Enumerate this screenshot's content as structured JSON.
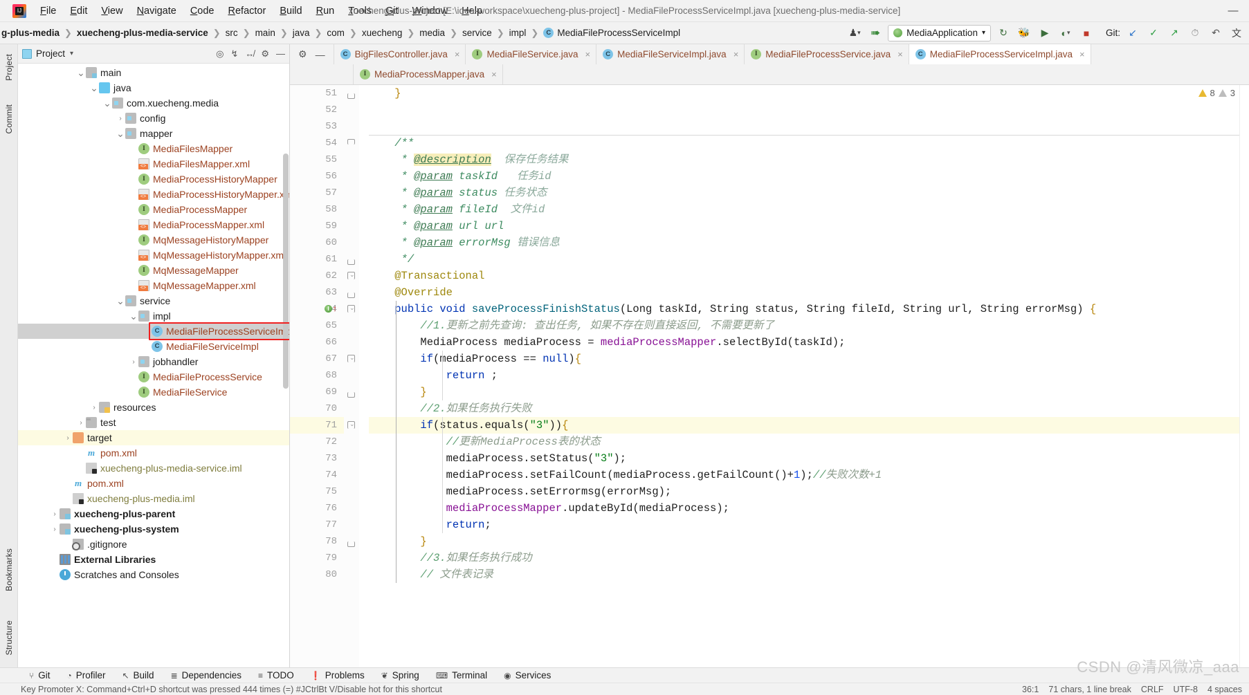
{
  "window": {
    "title": "xuecheng-plus-project [E:\\idea-workspace\\xuecheng-plus-project] - MediaFileProcessServiceImpl.java [xuecheng-plus-media-service]",
    "minimize_label": "—",
    "logo_name": "intellij-idea-logo"
  },
  "menu": [
    {
      "label": "File"
    },
    {
      "label": "Edit"
    },
    {
      "label": "View"
    },
    {
      "label": "Navigate"
    },
    {
      "label": "Code"
    },
    {
      "label": "Refactor"
    },
    {
      "label": "Build"
    },
    {
      "label": "Run"
    },
    {
      "label": "Tools"
    },
    {
      "label": "Git"
    },
    {
      "label": "Window"
    },
    {
      "label": "Help"
    }
  ],
  "breadcrumb": {
    "items": [
      {
        "label": "g-plus-media",
        "bold": true,
        "icon": ""
      },
      {
        "label": "xuecheng-plus-media-service",
        "bold": true,
        "icon": ""
      },
      {
        "label": "src",
        "bold": false,
        "icon": ""
      },
      {
        "label": "main",
        "bold": false,
        "icon": ""
      },
      {
        "label": "java",
        "bold": false,
        "icon": ""
      },
      {
        "label": "com",
        "bold": false,
        "icon": ""
      },
      {
        "label": "xuecheng",
        "bold": false,
        "icon": ""
      },
      {
        "label": "media",
        "bold": false,
        "icon": ""
      },
      {
        "label": "service",
        "bold": false,
        "icon": ""
      },
      {
        "label": "impl",
        "bold": false,
        "icon": ""
      },
      {
        "label": "MediaFileProcessServiceImpl",
        "bold": false,
        "icon": "class"
      }
    ]
  },
  "toolbar": {
    "run_config": "MediaApplication",
    "run_config_caret": "▾",
    "git_label": "Git:",
    "icons": [
      {
        "name": "user-avatar-icon",
        "glyph": "♟"
      },
      {
        "name": "hammer-build-icon",
        "glyph": "↖"
      },
      {
        "name": "rerun-icon",
        "glyph": "↻"
      },
      {
        "name": "debug-icon",
        "glyph": "⚙"
      },
      {
        "name": "run-with-coverage-icon",
        "glyph": "▶"
      },
      {
        "name": "profiler-icon",
        "glyph": "◔"
      },
      {
        "name": "stop-icon",
        "glyph": "■"
      },
      {
        "name": "git-update-icon",
        "glyph": "↙"
      },
      {
        "name": "git-commit-icon",
        "glyph": "✓"
      },
      {
        "name": "git-push-icon",
        "glyph": "↗"
      },
      {
        "name": "git-history-icon",
        "glyph": "◴"
      },
      {
        "name": "git-rollback-icon",
        "glyph": "↶"
      },
      {
        "name": "search-everywhere-icon",
        "glyph": "文"
      }
    ]
  },
  "left_stripe": {
    "top_label": "Project",
    "commit_label": "Commit",
    "bookmarks_label": "Bookmarks",
    "structure_label": "Structure"
  },
  "project_panel": {
    "title": "Project",
    "caret": "▾",
    "actions": [
      {
        "name": "select-opened-file-icon",
        "glyph": "⌖"
      },
      {
        "name": "expand-all-icon",
        "glyph": "⤓"
      },
      {
        "name": "collapse-all-icon",
        "glyph": "⤒"
      },
      {
        "name": "settings-gear-icon",
        "glyph": "⚙"
      },
      {
        "name": "hide-panel-icon",
        "glyph": "—"
      }
    ],
    "tree": [
      {
        "label": "main",
        "indent": 4,
        "arrow": "v",
        "icon": "folder-src",
        "color": "plain"
      },
      {
        "label": "java",
        "indent": 5,
        "arrow": "v",
        "icon": "folder-blue",
        "color": "plain"
      },
      {
        "label": "com.xuecheng.media",
        "indent": 6,
        "arrow": "v",
        "icon": "pkg",
        "color": "plain"
      },
      {
        "label": "config",
        "indent": 7,
        "arrow": ">",
        "icon": "pkg",
        "color": "plain"
      },
      {
        "label": "mapper",
        "indent": 7,
        "arrow": "v",
        "icon": "pkg",
        "color": "plain"
      },
      {
        "label": "MediaFilesMapper",
        "indent": 8,
        "arrow": "",
        "icon": "iface",
        "color": "brown"
      },
      {
        "label": "MediaFilesMapper.xml",
        "indent": 8,
        "arrow": "",
        "icon": "xml",
        "color": "brown"
      },
      {
        "label": "MediaProcessHistoryMapper",
        "indent": 8,
        "arrow": "",
        "icon": "iface",
        "color": "brown"
      },
      {
        "label": "MediaProcessHistoryMapper.xml",
        "indent": 8,
        "arrow": "",
        "icon": "xml",
        "color": "brown"
      },
      {
        "label": "MediaProcessMapper",
        "indent": 8,
        "arrow": "",
        "icon": "iface",
        "color": "brown"
      },
      {
        "label": "MediaProcessMapper.xml",
        "indent": 8,
        "arrow": "",
        "icon": "xml",
        "color": "brown"
      },
      {
        "label": "MqMessageHistoryMapper",
        "indent": 8,
        "arrow": "",
        "icon": "iface",
        "color": "brown"
      },
      {
        "label": "MqMessageHistoryMapper.xml",
        "indent": 8,
        "arrow": "",
        "icon": "xml",
        "color": "brown"
      },
      {
        "label": "MqMessageMapper",
        "indent": 8,
        "arrow": "",
        "icon": "iface",
        "color": "brown"
      },
      {
        "label": "MqMessageMapper.xml",
        "indent": 8,
        "arrow": "",
        "icon": "xml",
        "color": "brown"
      },
      {
        "label": "service",
        "indent": 7,
        "arrow": "v",
        "icon": "pkg",
        "color": "plain"
      },
      {
        "label": "impl",
        "indent": 8,
        "arrow": "v",
        "icon": "pkg",
        "color": "plain"
      },
      {
        "label": "MediaFileProcessServiceImpl",
        "indent": 9,
        "arrow": "",
        "icon": "clazz",
        "color": "brown",
        "selected": true,
        "highlight_box": true
      },
      {
        "label": "MediaFileServiceImpl",
        "indent": 9,
        "arrow": "",
        "icon": "clazz",
        "color": "brown"
      },
      {
        "label": "jobhandler",
        "indent": 8,
        "arrow": ">",
        "icon": "pkg",
        "color": "plain"
      },
      {
        "label": "MediaFileProcessService",
        "indent": 8,
        "arrow": "",
        "icon": "iface",
        "color": "brown"
      },
      {
        "label": "MediaFileService",
        "indent": 8,
        "arrow": "",
        "icon": "iface",
        "color": "brown"
      },
      {
        "label": "resources",
        "indent": 5,
        "arrow": ">",
        "icon": "folder-res",
        "color": "plain"
      },
      {
        "label": "test",
        "indent": 4,
        "arrow": ">",
        "icon": "folder",
        "color": "plain"
      },
      {
        "label": "target",
        "indent": 3,
        "arrow": ">",
        "icon": "folder-orange",
        "color": "plain",
        "marked": true
      },
      {
        "label": "pom.xml",
        "indent": 4,
        "arrow": "",
        "icon": "maven",
        "color": "brown"
      },
      {
        "label": "xuecheng-plus-media-service.iml",
        "indent": 4,
        "arrow": "",
        "icon": "iml",
        "color": "olive"
      },
      {
        "label": "pom.xml",
        "indent": 3,
        "arrow": "",
        "icon": "maven",
        "color": "brown"
      },
      {
        "label": "xuecheng-plus-media.iml",
        "indent": 3,
        "arrow": "",
        "icon": "iml",
        "color": "olive"
      },
      {
        "label": "xuecheng-plus-parent",
        "indent": 2,
        "arrow": ">",
        "icon": "module",
        "color": "bold"
      },
      {
        "label": "xuecheng-plus-system",
        "indent": 2,
        "arrow": ">",
        "icon": "module",
        "color": "bold"
      },
      {
        "label": ".gitignore",
        "indent": 3,
        "arrow": "",
        "icon": "gitignore",
        "color": "plain"
      },
      {
        "label": "External Libraries",
        "indent": 2,
        "arrow": "",
        "icon": "lib",
        "color": "bold"
      },
      {
        "label": "Scratches and Consoles",
        "indent": 2,
        "arrow": "",
        "icon": "scratch",
        "color": "plain"
      }
    ]
  },
  "editor": {
    "tab_actions": [
      {
        "name": "settings-gear-icon",
        "glyph": "⚙"
      },
      {
        "name": "hide-editor-icon",
        "glyph": "—"
      }
    ],
    "tabs_row1": [
      {
        "label": "BigFilesController.java",
        "kind": "class",
        "active": false
      },
      {
        "label": "MediaFileService.java",
        "kind": "interface",
        "active": false
      },
      {
        "label": "MediaFileServiceImpl.java",
        "kind": "class",
        "active": false
      },
      {
        "label": "MediaFileProcessService.java",
        "kind": "interface",
        "active": false
      },
      {
        "label": "MediaFileProcessServiceImpl.java",
        "kind": "class",
        "active": true
      }
    ],
    "tabs_row2": [
      {
        "label": "MediaProcessMapper.java",
        "kind": "interface",
        "active": false
      }
    ],
    "close_glyph": "×",
    "inspection": {
      "warnings": "8",
      "weak_warnings": "3",
      "warn_icon": "warning-triangle-icon"
    },
    "first_line": 51,
    "lines": [
      {
        "n": 51,
        "fold": "close",
        "html": "    <span class='brace-y'>}</span>"
      },
      {
        "n": 52,
        "fold": "",
        "html": ""
      },
      {
        "n": 53,
        "fold": "",
        "html": ""
      },
      {
        "n": 54,
        "fold": "open",
        "sep": true,
        "html": "    <span class='jdoc'>/**</span>"
      },
      {
        "n": 55,
        "fold": "",
        "html": "     <span class='jdoc'>* </span><span class='jdoc-tag hl'>@description</span><span class='jdoc-txt'>  保存任务结果</span>"
      },
      {
        "n": 56,
        "fold": "",
        "html": "     <span class='jdoc'>* </span><span class='jdoc-tag'>@param</span><span class='jdoc'> taskId</span><span class='jdoc-txt'>   任务id</span>"
      },
      {
        "n": 57,
        "fold": "",
        "html": "     <span class='jdoc'>* </span><span class='jdoc-tag'>@param</span><span class='jdoc'> status</span><span class='jdoc-txt'> 任务状态</span>"
      },
      {
        "n": 58,
        "fold": "",
        "html": "     <span class='jdoc'>* </span><span class='jdoc-tag'>@param</span><span class='jdoc'> fileId</span><span class='jdoc-txt'>  文件id</span>"
      },
      {
        "n": 59,
        "fold": "",
        "html": "     <span class='jdoc'>* </span><span class='jdoc-tag'>@param</span><span class='jdoc'> url url</span>"
      },
      {
        "n": 60,
        "fold": "",
        "html": "     <span class='jdoc'>* </span><span class='jdoc-tag'>@param</span><span class='jdoc'> errorMsg</span><span class='jdoc-txt'> 错误信息</span>"
      },
      {
        "n": 61,
        "fold": "close",
        "html": "     <span class='jdoc'>*/</span>"
      },
      {
        "n": 62,
        "fold": "collapse",
        "html": "    <span class='anno'>@Transactional</span>"
      },
      {
        "n": 63,
        "fold": "close",
        "html": "    <span class='anno'>@Override</span>"
      },
      {
        "n": 64,
        "fold": "collapse",
        "run": true,
        "html": "    <span class='kw'>public</span> <span class='kw'>void</span> <span class='fn'>saveProcessFinishStatus</span><span class='punc'>(</span><span class='typ'>Long taskId, String status, String fileId, String url, String errorMsg</span><span class='punc'>)</span> <span class='brace-y'>{</span>"
      },
      {
        "n": 65,
        "fold": "",
        "html": "        <span class='cmt-green'>//1.</span><span class='cmt-chs'>更新之前先查询: 查出任务, 如果不存在则直接返回, 不需要更新了</span>"
      },
      {
        "n": 66,
        "fold": "",
        "html": "        <span class='typ'>MediaProcess mediaProcess</span> <span class='punc'>=</span> <span class='fld'>mediaProcessMapper</span><span class='punc'>.</span><span class='typ'>selectById</span><span class='punc'>(</span><span class='typ'>taskId</span><span class='punc'>);</span>"
      },
      {
        "n": 67,
        "fold": "collapse",
        "html": "        <span class='kw'>if</span><span class='punc'>(</span><span class='typ'>mediaProcess</span> <span class='punc'>==</span> <span class='kw'>null</span><span class='punc'>)</span><span class='brace-y'>{</span>"
      },
      {
        "n": 68,
        "fold": "",
        "html": "            <span class='kw'>return</span> <span class='punc'>;</span>"
      },
      {
        "n": 69,
        "fold": "close",
        "html": "        <span class='brace-y'>}</span>"
      },
      {
        "n": 70,
        "fold": "",
        "html": "        <span class='cmt-green'>//2.</span><span class='cmt-chs'>如果任务执行失败</span>"
      },
      {
        "n": 71,
        "fold": "collapse",
        "marked": true,
        "html": "        <span class='kw'>if</span><span class='punc'>(</span><span class='typ'>status</span><span class='punc'>.</span><span class='typ'>equals</span><span class='punc'>(</span><span class='str'>\"3\"</span><span class='punc'>))</span><span class='brace-y'>{</span>"
      },
      {
        "n": 72,
        "fold": "",
        "html": "            <span class='cmt-green'>//</span><span class='cmt-chs'>更新MediaProcess表的状态</span>"
      },
      {
        "n": 73,
        "fold": "",
        "html": "            <span class='typ'>mediaProcess</span><span class='punc'>.</span><span class='typ'>setStatus</span><span class='punc'>(</span><span class='str'>\"3\"</span><span class='punc'>);</span>"
      },
      {
        "n": 74,
        "fold": "",
        "html": "            <span class='typ'>mediaProcess</span><span class='punc'>.</span><span class='typ'>setFailCount</span><span class='punc'>(</span><span class='typ'>mediaProcess</span><span class='punc'>.</span><span class='typ'>getFailCount</span><span class='punc'>()+</span><span class='num'>1</span><span class='punc'>);</span><span class='cmt-green'>//</span><span class='cmt-chs'>失败次数+1</span>"
      },
      {
        "n": 75,
        "fold": "",
        "html": "            <span class='typ'>mediaProcess</span><span class='punc'>.</span><span class='typ'>setErrormsg</span><span class='punc'>(</span><span class='typ'>errorMsg</span><span class='punc'>);</span>"
      },
      {
        "n": 76,
        "fold": "",
        "html": "            <span class='fld'>mediaProcessMapper</span><span class='punc'>.</span><span class='typ'>updateById</span><span class='punc'>(</span><span class='typ'>mediaProcess</span><span class='punc'>);</span>"
      },
      {
        "n": 77,
        "fold": "",
        "html": "            <span class='kw'>return</span><span class='punc'>;</span>"
      },
      {
        "n": 78,
        "fold": "close",
        "html": "        <span class='brace-y'>}</span>"
      },
      {
        "n": 79,
        "fold": "",
        "html": "        <span class='cmt-green'>//3.</span><span class='cmt-chs'>如果任务执行成功</span>"
      },
      {
        "n": 80,
        "fold": "",
        "html": "        <span class='cmt-green'>// </span><span class='cmt-chs'>文件表记录</span>"
      }
    ]
  },
  "bottom_bar": [
    {
      "label": "Git",
      "icon": "git-branch-icon",
      "glyph": "⑂"
    },
    {
      "label": "Profiler",
      "icon": "profiler-icon",
      "glyph": "◔"
    },
    {
      "label": "Build",
      "icon": "hammer-icon",
      "glyph": "↖"
    },
    {
      "label": "Dependencies",
      "icon": "dependencies-icon",
      "glyph": "≣"
    },
    {
      "label": "TODO",
      "icon": "todo-list-icon",
      "glyph": "≡"
    },
    {
      "label": "Problems",
      "icon": "problems-icon",
      "glyph": "❗"
    },
    {
      "label": "Spring",
      "icon": "spring-leaf-icon",
      "glyph": "❦"
    },
    {
      "label": "Terminal",
      "icon": "terminal-icon",
      "glyph": "⌨"
    },
    {
      "label": "Services",
      "icon": "services-icon",
      "glyph": "◉"
    }
  ],
  "status_strip": {
    "left": "Key Promoter X: Command+Ctrl+D shortcut was pressed 444 times (=) #JCtrlBt V/Disable hot for this shortcut",
    "caret": "36:1",
    "line_sep": "71 chars, 1 line break",
    "indent": "CRLF",
    "encoding": "UTF-8",
    "spaces": "4 spaces"
  },
  "watermark": {
    "text": "CSDN @清风微凉_aaa"
  }
}
